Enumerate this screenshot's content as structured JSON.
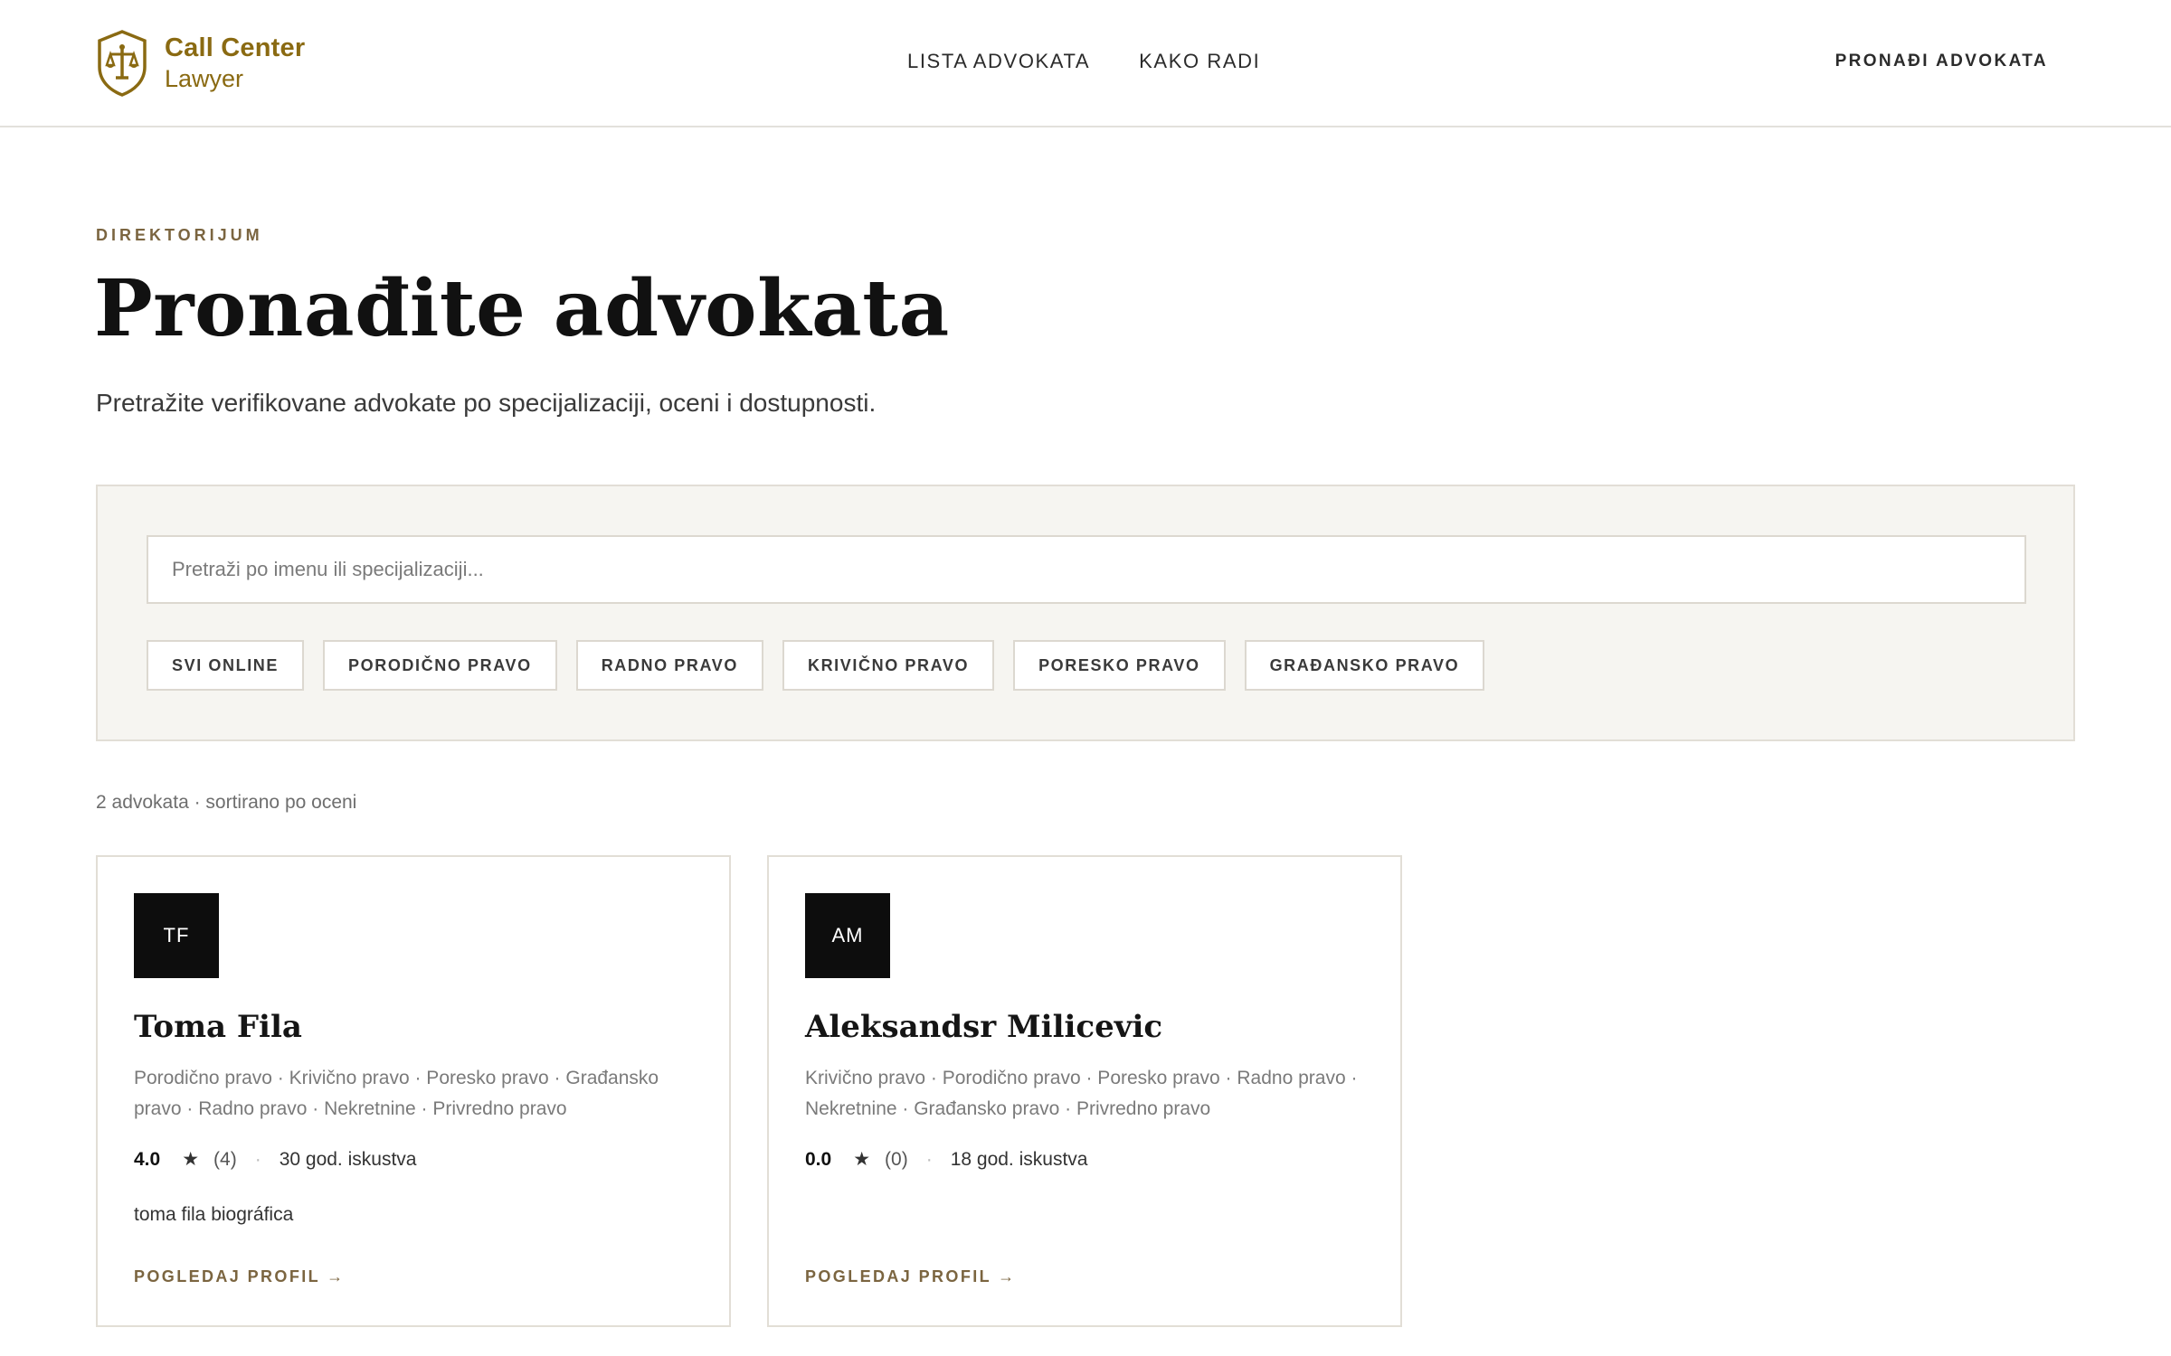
{
  "brand": {
    "name_line1": "Call Center",
    "name_line2": "Lawyer"
  },
  "nav": {
    "items": [
      {
        "label": "LISTA ADVOKATA"
      },
      {
        "label": "KAKO RADI"
      }
    ],
    "cta": "PRONAĐI ADVOKATA"
  },
  "hero": {
    "eyebrow": "DIREKTORIJUM",
    "title": "Pronađite advokata",
    "subtitle": "Pretražite verifikovane advokate po specijalizaciji, oceni i dostupnosti."
  },
  "search": {
    "placeholder": "Pretraži po imenu ili specijalizaciji...",
    "value": "",
    "filters": [
      {
        "label": "SVI ONLINE"
      },
      {
        "label": "PORODIČNO PRAVO"
      },
      {
        "label": "RADNO PRAVO"
      },
      {
        "label": "KRIVIČNO PRAVO"
      },
      {
        "label": "PORESKO PRAVO"
      },
      {
        "label": "GRAĐANSKO PRAVO"
      }
    ]
  },
  "results": {
    "summary": "2 advokata · sortirano po oceni",
    "lawyers": [
      {
        "initials": "TF",
        "name": "Toma Fila",
        "specializations": "Porodično pravo · Krivično pravo · Poresko pravo · Građansko pravo · Radno pravo · Nekretnine · Privredno pravo",
        "rating": "4.0",
        "star": "★",
        "reviews": "(4)",
        "separator": "·",
        "experience": "30 god. iskustva",
        "bio": "toma fila biográfica",
        "link": "POGLEDAJ PROFIL →"
      },
      {
        "initials": "AM",
        "name": "Aleksandsr Milicevic",
        "specializations": "Krivično pravo · Porodično pravo · Poresko pravo · Radno pravo · Nekretnine · Građansko pravo · Privredno pravo",
        "rating": "0.0",
        "star": "★",
        "reviews": "(0)",
        "separator": "·",
        "experience": "18 god. iskustva",
        "bio": "",
        "link": "POGLEDAJ PROFIL →"
      }
    ]
  },
  "colors": {
    "accent": "#8a6a12",
    "eyebrow": "#7b6540",
    "panel_bg": "#f6f5f1",
    "avatar_bg": "#0d0d0d"
  },
  "icons": {
    "logo": "scales-shield-icon"
  }
}
